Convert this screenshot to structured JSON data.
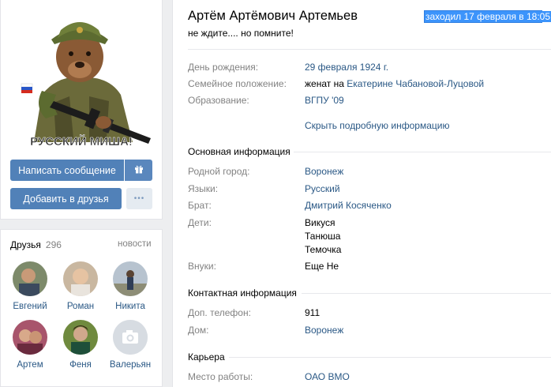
{
  "profile": {
    "name": "Артём Артёмович Артемьев",
    "last_seen": "заходил 17 февраля в 18:05",
    "status": "не ждите.... но помните!",
    "avatar_caption": "РУССКИЙ МИША!"
  },
  "actions": {
    "message_label": "Написать сообщение",
    "add_friend_label": "Добавить в друзья",
    "more_label": "•••"
  },
  "friends": {
    "title": "Друзья",
    "count": "296",
    "news_label": "новости",
    "items": [
      {
        "name": "Евгений"
      },
      {
        "name": "Роман"
      },
      {
        "name": "Никита"
      },
      {
        "name": "Артем"
      },
      {
        "name": "Феня"
      },
      {
        "name": "Валерьян"
      }
    ]
  },
  "info": {
    "birthday_label": "День рождения:",
    "birthday_value": "29 февраля 1924 г.",
    "family_label": "Семейное положение:",
    "family_prefix": "женат на",
    "family_link": "Екатерине Чабановой-Луцовой",
    "education_label": "Образование:",
    "education_value": "ВГПУ '09",
    "hide_details": "Скрыть подробную информацию"
  },
  "basic": {
    "title": "Основная информация",
    "hometown_label": "Родной город:",
    "hometown_value": "Воронеж",
    "languages_label": "Языки:",
    "languages_value": "Русский",
    "brother_label": "Брат:",
    "brother_value": "Дмитрий Косяченко",
    "children_label": "Дети:",
    "children": [
      "Викуся",
      "Танюша",
      "Темочка"
    ],
    "grandchildren_label": "Внуки:",
    "grandchildren_value": "Еще Не"
  },
  "contact": {
    "title": "Контактная информация",
    "phone_label": "Доп. телефон:",
    "phone_value": "911",
    "home_label": "Дом:",
    "home_value": "Воронеж"
  },
  "career": {
    "title": "Карьера",
    "work_label": "Место работы:",
    "work_value": "ОАО ВМО"
  }
}
